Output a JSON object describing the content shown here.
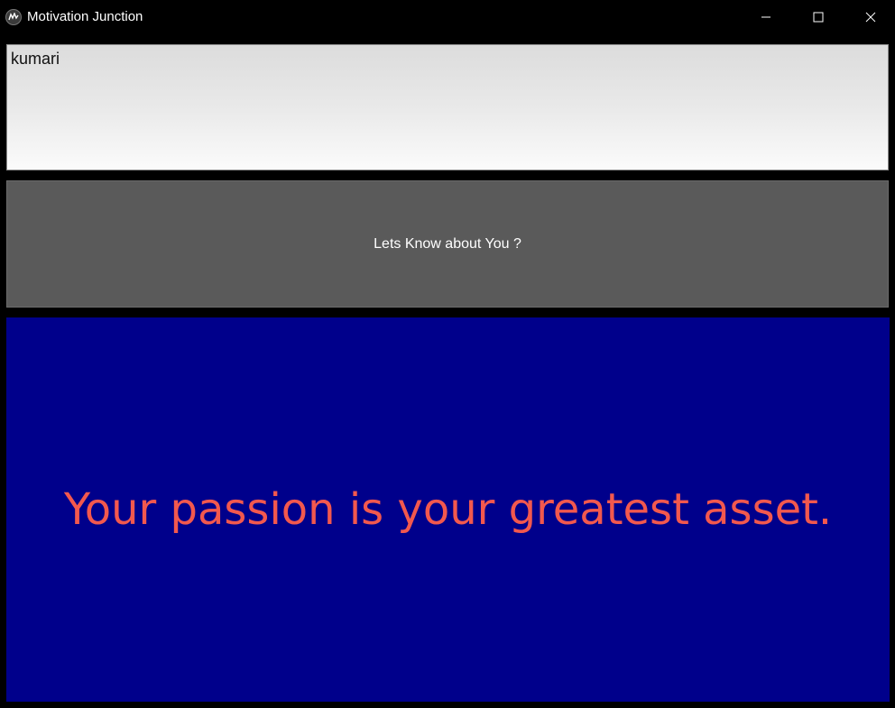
{
  "window": {
    "title": "Motivation Junction",
    "icon": "kivy-logo-icon",
    "controls": {
      "minimize_icon": "minimize-icon",
      "maximize_icon": "maximize-icon",
      "close_icon": "close-icon"
    }
  },
  "name_input": {
    "value": "kumari"
  },
  "action_button": {
    "label": "Lets Know about You ?"
  },
  "quote_panel": {
    "text": "Your passion is your greatest asset.",
    "background_color": "#00008b",
    "text_color": "#f2584e"
  }
}
